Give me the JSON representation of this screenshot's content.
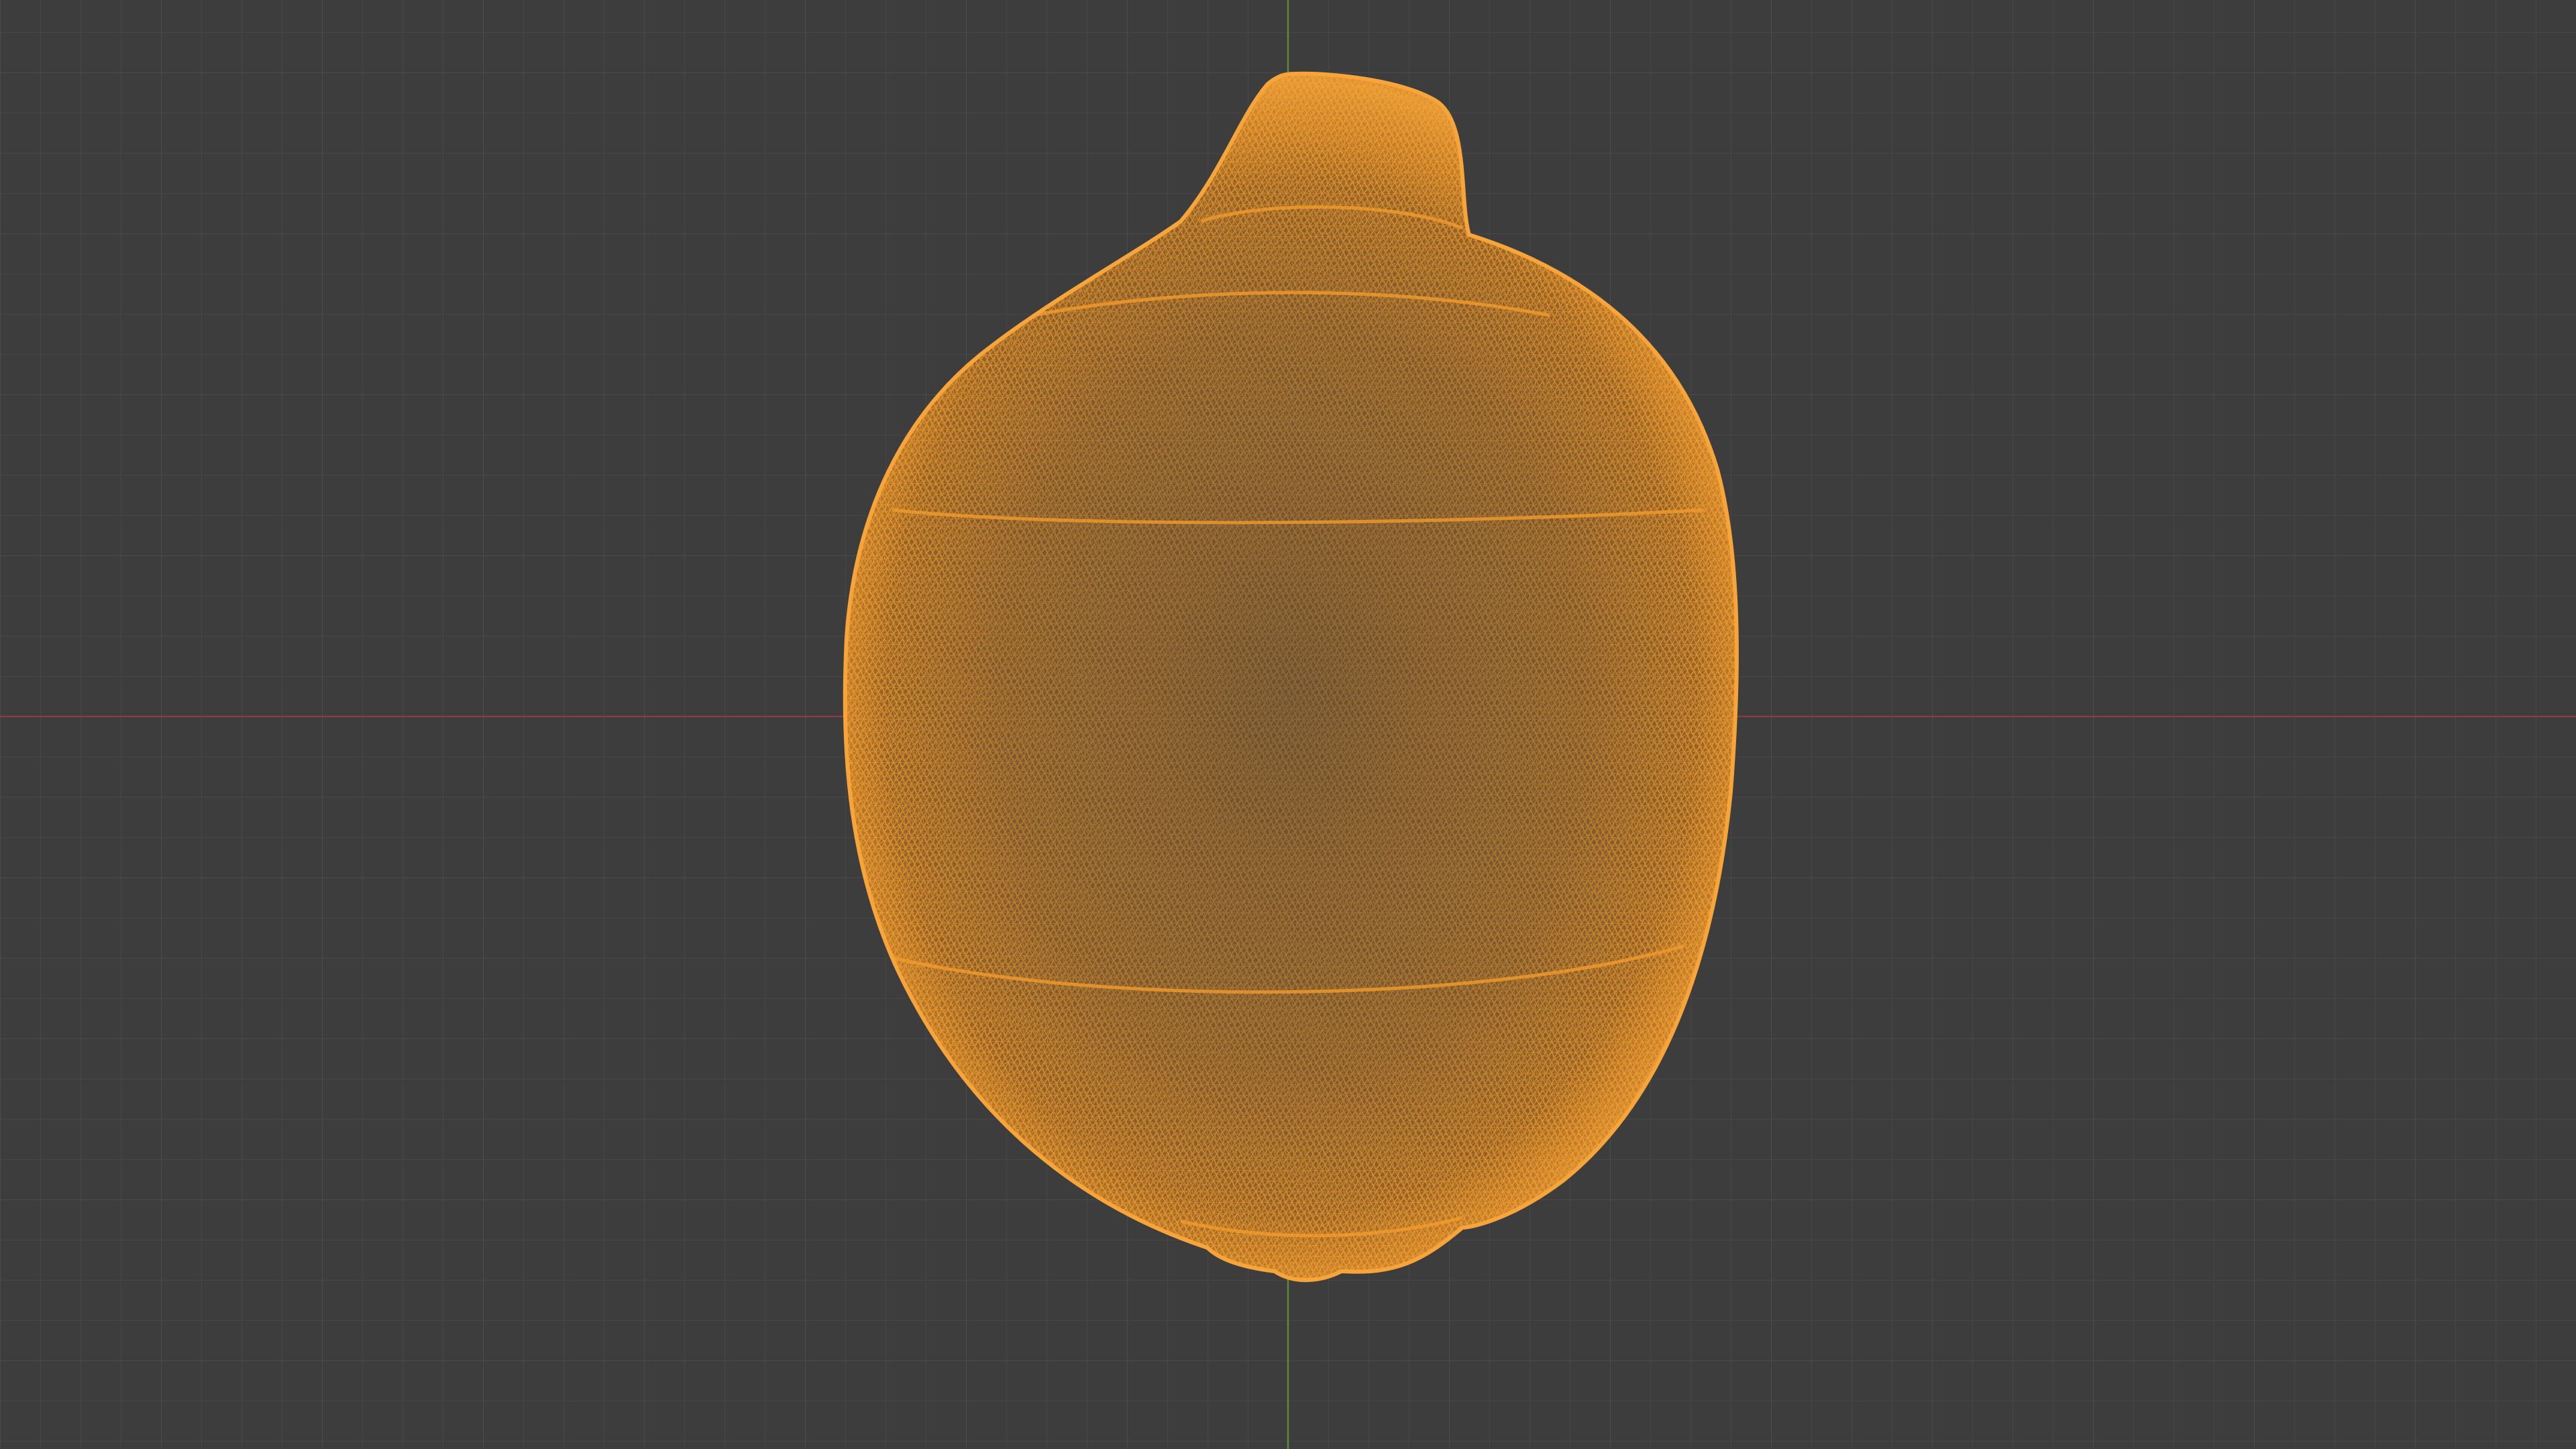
{
  "viewport": {
    "mode": "wireframe",
    "background_color": "#3d3d3d",
    "grid_color_minor": "#464646",
    "grid_color_major": "#4f4f4f",
    "x_axis_color": "#8a3b48",
    "y_axis_color": "#5c8a3a",
    "wire_color": "#f29b2c",
    "wire_fill_color": "#a4661f",
    "object": {
      "name_icon": "lemon-mesh-icon",
      "state": "selected"
    }
  }
}
